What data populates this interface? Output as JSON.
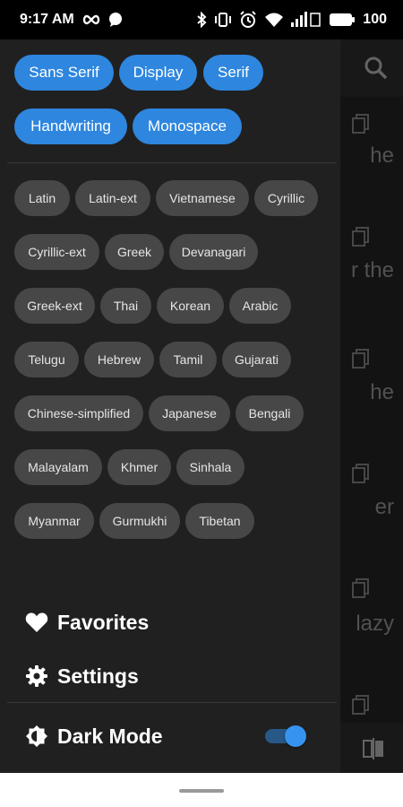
{
  "status_bar": {
    "time": "9:17 AM",
    "battery": "100",
    "icons": [
      "infinity-icon",
      "chat-bubble-icon",
      "bluetooth-icon",
      "vibrate-icon",
      "alarm-icon",
      "wifi-icon",
      "signal-icon",
      "battery-icon"
    ]
  },
  "background": {
    "snippets": [
      "he",
      "r the",
      "he",
      "er",
      "lazy"
    ],
    "icons": [
      "search-icon",
      "copy-icon",
      "swap-icon"
    ]
  },
  "drawer": {
    "categories": [
      "Sans Serif",
      "Display",
      "Serif",
      "Handwriting",
      "Monospace"
    ],
    "subsets": [
      "Latin",
      "Latin-ext",
      "Vietnamese",
      "Cyrillic",
      "Cyrillic-ext",
      "Greek",
      "Devanagari",
      "Greek-ext",
      "Thai",
      "Korean",
      "Arabic",
      "Telugu",
      "Hebrew",
      "Tamil",
      "Gujarati",
      "Chinese-simplified",
      "Japanese",
      "Bengali",
      "Malayalam",
      "Khmer",
      "Sinhala",
      "Myanmar",
      "Gurmukhi",
      "Tibetan"
    ],
    "menu": {
      "favorites": "Favorites",
      "settings": "Settings",
      "dark_mode": "Dark Mode"
    },
    "dark_mode_enabled": true
  },
  "colors": {
    "accent": "#2e86de",
    "drawer_bg": "#202020",
    "chip_secondary": "#474747"
  }
}
